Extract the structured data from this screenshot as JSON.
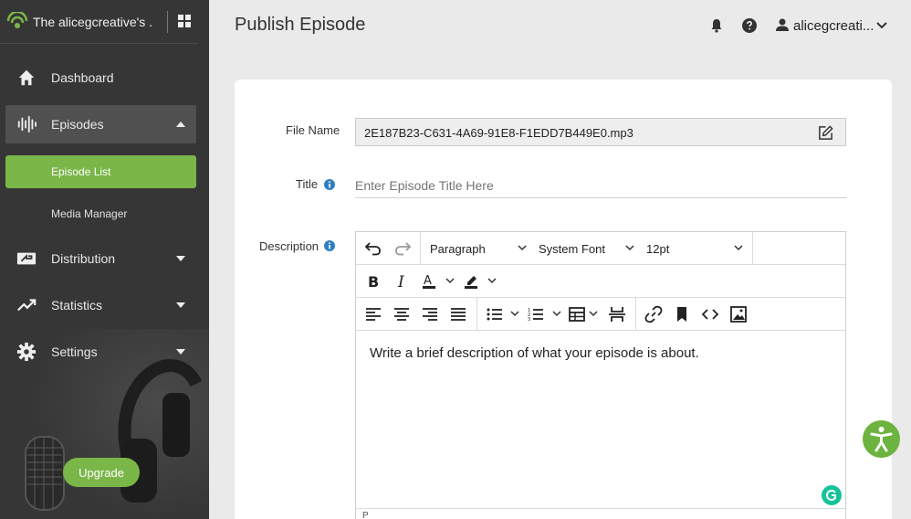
{
  "sidebar": {
    "title": "The alicegcreative's ...",
    "items": [
      {
        "label": "Dashboard",
        "icon": "home-icon"
      },
      {
        "label": "Episodes",
        "icon": "waveform-icon"
      },
      {
        "label": "Distribution",
        "icon": "distribution-icon"
      },
      {
        "label": "Statistics",
        "icon": "trending-icon"
      },
      {
        "label": "Settings",
        "icon": "gear-icon"
      }
    ],
    "subitems": [
      {
        "label": "Episode List"
      },
      {
        "label": "Media Manager"
      }
    ],
    "upgrade_label": "Upgrade"
  },
  "header": {
    "page_title": "Publish Episode",
    "user_name": "alicegcreati..."
  },
  "form": {
    "file_name_label": "File Name",
    "file_name_value": "2E187B23-C631-4A69-91E8-F1EDD7B449E0.mp3",
    "title_label": "Title",
    "title_placeholder": "Enter Episode Title Here",
    "description_label": "Description",
    "editor": {
      "block_format": "Paragraph",
      "font_family": "System Font",
      "font_size": "12pt",
      "body_text": "Write a brief description of what your episode is about.",
      "status_path": "P"
    }
  },
  "colors": {
    "accent_green": "#7ab648",
    "sidebar_bg": "#363636",
    "info_blue": "#2f7fc1"
  }
}
